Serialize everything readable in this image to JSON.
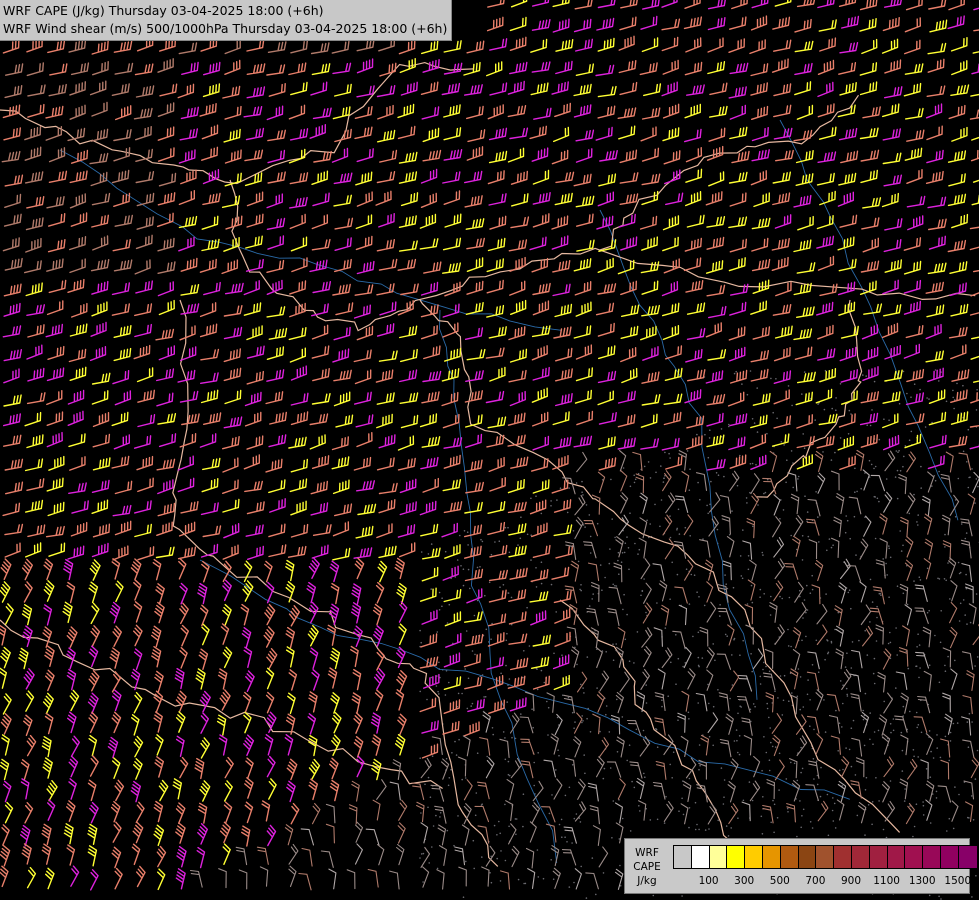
{
  "title": {
    "line1": "WRF CAPE (J/kg) Thursday 03-04-2025 18:00 (+6h)",
    "line2": "WRF Wind shear (m/s) 500/1000hPa Thursday 03-04-2025 18:00 (+6h)"
  },
  "legend": {
    "line1": "WRF",
    "line2": "CAPE",
    "unit": "J/kg",
    "tick_labels": [
      "100",
      "300",
      "500",
      "700",
      "900",
      "1100",
      "1300",
      "1500"
    ],
    "colors": [
      "#c8c8c8",
      "#ffffff",
      "#ffff99",
      "#ffff00",
      "#ffcc00",
      "#e69500",
      "#b05a10",
      "#8b4513",
      "#a0522d",
      "#a03030",
      "#a02838",
      "#a02040",
      "#a01848",
      "#a01050",
      "#980858",
      "#900060",
      "#880068"
    ]
  },
  "wind_colors": {
    "salmon": "#e87f6a",
    "magenta": "#dd22dd",
    "yellow": "#ffff33",
    "rosy": "#b07a6a",
    "gray": "#9a8b88",
    "light": "#b0a8a8"
  },
  "map_colors": {
    "border": "#e6b8a0",
    "river": "#2a6aa8",
    "background": "#000000"
  }
}
